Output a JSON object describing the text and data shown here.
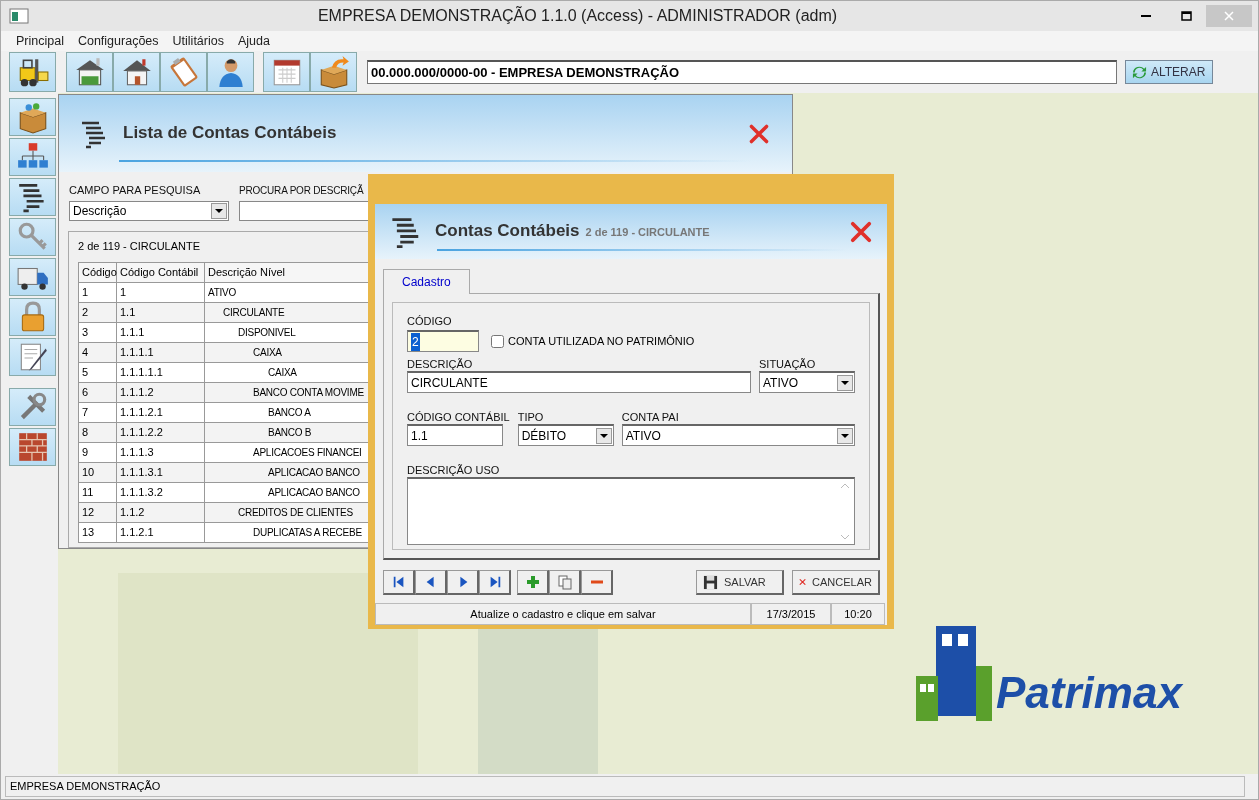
{
  "window": {
    "title": "EMPRESA DEMONSTRAÇÃO 1.1.0 (Access) - ADMINISTRADOR (adm)"
  },
  "menu": [
    "Principal",
    "Configurações",
    "Utilitários",
    "Ajuda"
  ],
  "toolbar": {
    "company": "00.000.000/0000-00 - EMPRESA DEMONSTRAÇÃO",
    "alter_button": "ALTERAR"
  },
  "list_window": {
    "title": "Lista de Contas Contábeis",
    "search_field_label": "CAMPO PARA PESQUISA",
    "search_field_value": "Descrição",
    "search_text_label": "PROCURA POR DESCRIÇÃ",
    "record_caption": "2 de 119 - CIRCULANTE",
    "columns": [
      "Código",
      "Código Contábil",
      "Descrição Nível"
    ],
    "rows": [
      {
        "code": "1",
        "account": "1",
        "description": "ATIVO",
        "children": [
          {
            "code": "2",
            "account": "1.1",
            "description": "CIRCULANTE",
            "children": [
              {
                "code": "3",
                "account": "1.1.1",
                "description": "DISPONIVEL",
                "children": [
                  {
                    "code": "4",
                    "account": "1.1.1.1",
                    "description": "CAIXA",
                    "children": [
                      {
                        "code": "5",
                        "account": "1.1.1.1.1",
                        "description": "CAIXA"
                      }
                    ]
                  },
                  {
                    "code": "6",
                    "account": "1.1.1.2",
                    "description": "BANCO CONTA MOVIME",
                    "children": [
                      {
                        "code": "7",
                        "account": "1.1.1.2.1",
                        "description": "BANCO A"
                      },
                      {
                        "code": "8",
                        "account": "1.1.1.2.2",
                        "description": "BANCO B"
                      }
                    ]
                  },
                  {
                    "code": "9",
                    "account": "1.1.1.3",
                    "description": "APLICACOES FINANCEI",
                    "children": [
                      {
                        "code": "10",
                        "account": "1.1.1.3.1",
                        "description": "APLICACAO BANCO"
                      },
                      {
                        "code": "11",
                        "account": "1.1.1.3.2",
                        "description": "APLICACAO BANCO"
                      }
                    ]
                  }
                ]
              },
              {
                "code": "12",
                "account": "1.1.2",
                "description": "CREDITOS DE CLIENTES",
                "children": [
                  {
                    "code": "13",
                    "account": "1.1.2.1",
                    "description": "DUPLICATAS A RECEBE"
                  }
                ]
              }
            ]
          }
        ]
      }
    ]
  },
  "dialog": {
    "title": "Contas Contábeis",
    "subtitle": "2 de 119 - CIRCULANTE",
    "tabs": [
      {
        "label": "Cadastro",
        "selected": true
      }
    ],
    "code": {
      "label": "CÓDIGO",
      "value": "2"
    },
    "asset_checkbox": {
      "label": "CONTA UTILIZADA NO PATRIMÔNIO",
      "checked": false
    },
    "description": {
      "label": "DESCRIÇÃO",
      "value": "CIRCULANTE"
    },
    "status": {
      "label": "SITUAÇÃO",
      "value": "ATIVO"
    },
    "account_code": {
      "label": "CÓDIGO CONTÁBIL",
      "value": "1.1"
    },
    "type": {
      "label": "TIPO",
      "value": "DÉBITO"
    },
    "parent_account": {
      "label": "CONTA PAI",
      "value": "ATIVO"
    },
    "usage": {
      "label": "DESCRIÇÃO USO"
    },
    "save_button": "SALVAR",
    "cancel_button": "CANCELAR",
    "status_bar": {
      "message": "Atualize o cadastro e clique em salvar",
      "date": "17/3/2015",
      "time": "10:20"
    }
  },
  "logo": {
    "text": "Patrimax"
  },
  "status_bar": {
    "text": "EMPRESA DEMONSTRAÇÃO"
  }
}
